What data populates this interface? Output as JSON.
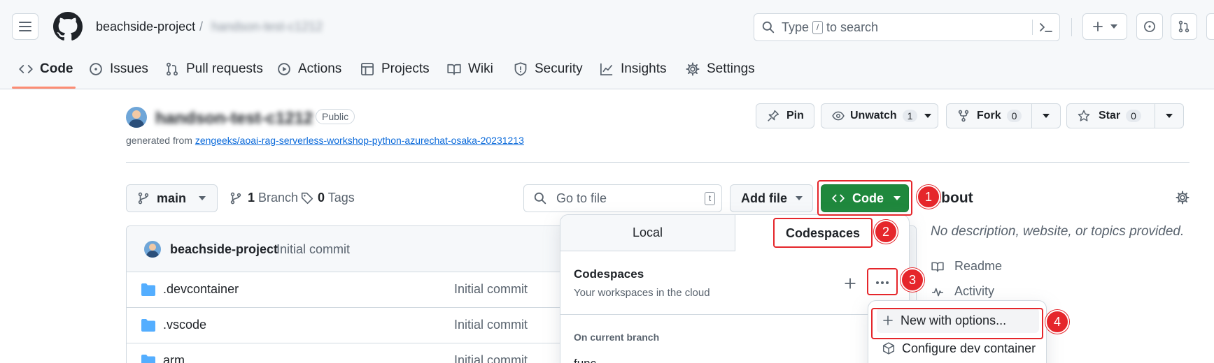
{
  "header": {
    "owner": "beachside-project",
    "separator": "/",
    "repo_name": "handson-test-c1212",
    "search_placeholder_pre": "Type",
    "search_key": "/",
    "search_placeholder_post": "to search"
  },
  "tabs": [
    {
      "label": "Code",
      "icon": "code-icon"
    },
    {
      "label": "Issues",
      "icon": "issue-icon"
    },
    {
      "label": "Pull requests",
      "icon": "pull-request-icon"
    },
    {
      "label": "Actions",
      "icon": "play-icon"
    },
    {
      "label": "Projects",
      "icon": "table-icon"
    },
    {
      "label": "Wiki",
      "icon": "book-icon"
    },
    {
      "label": "Security",
      "icon": "shield-icon"
    },
    {
      "label": "Insights",
      "icon": "graph-icon"
    },
    {
      "label": "Settings",
      "icon": "gear-icon"
    }
  ],
  "repo": {
    "name": "handson-test-c1212",
    "visibility": "Public",
    "generated_from_label": "generated from",
    "generated_from_link": "zengeeks/aoai-rag-serverless-workshop-python-azurechat-osaka-20231213",
    "pin_label": "Pin",
    "unwatch_label": "Unwatch",
    "unwatch_count": "1",
    "fork_label": "Fork",
    "fork_count": "0",
    "star_label": "Star",
    "star_count": "0"
  },
  "toolbar": {
    "branch": "main",
    "branch_count": "1",
    "branch_label": "Branch",
    "tag_count": "0",
    "tag_label": "Tags",
    "goto_placeholder": "Go to file",
    "goto_key": "t",
    "add_file_label": "Add file",
    "code_label": "Code"
  },
  "latest_commit": {
    "author": "beachside-project",
    "message": "Initial commit"
  },
  "files": [
    {
      "name": ".devcontainer",
      "message": "Initial commit"
    },
    {
      "name": ".vscode",
      "message": "Initial commit"
    },
    {
      "name": "arm",
      "message": "Initial commit"
    }
  ],
  "dropdown": {
    "tab_local": "Local",
    "tab_codespaces": "Codespaces",
    "section_title": "Codespaces",
    "section_sub": "Your workspaces in the cloud",
    "on_branch_label": "On current branch",
    "partial_item": "func..."
  },
  "submenu": {
    "new_with_options": "New with options...",
    "configure": "Configure dev container"
  },
  "about": {
    "title": "About",
    "description": "No description, website, or topics provided.",
    "readme": "Readme",
    "activity": "Activity"
  },
  "annotations": [
    "1",
    "2",
    "3",
    "4"
  ],
  "colors": {
    "code_button": "#1f883d",
    "annotation_red": "#e5262b",
    "tab_underline": "#fd8c73",
    "link": "#0969da"
  }
}
